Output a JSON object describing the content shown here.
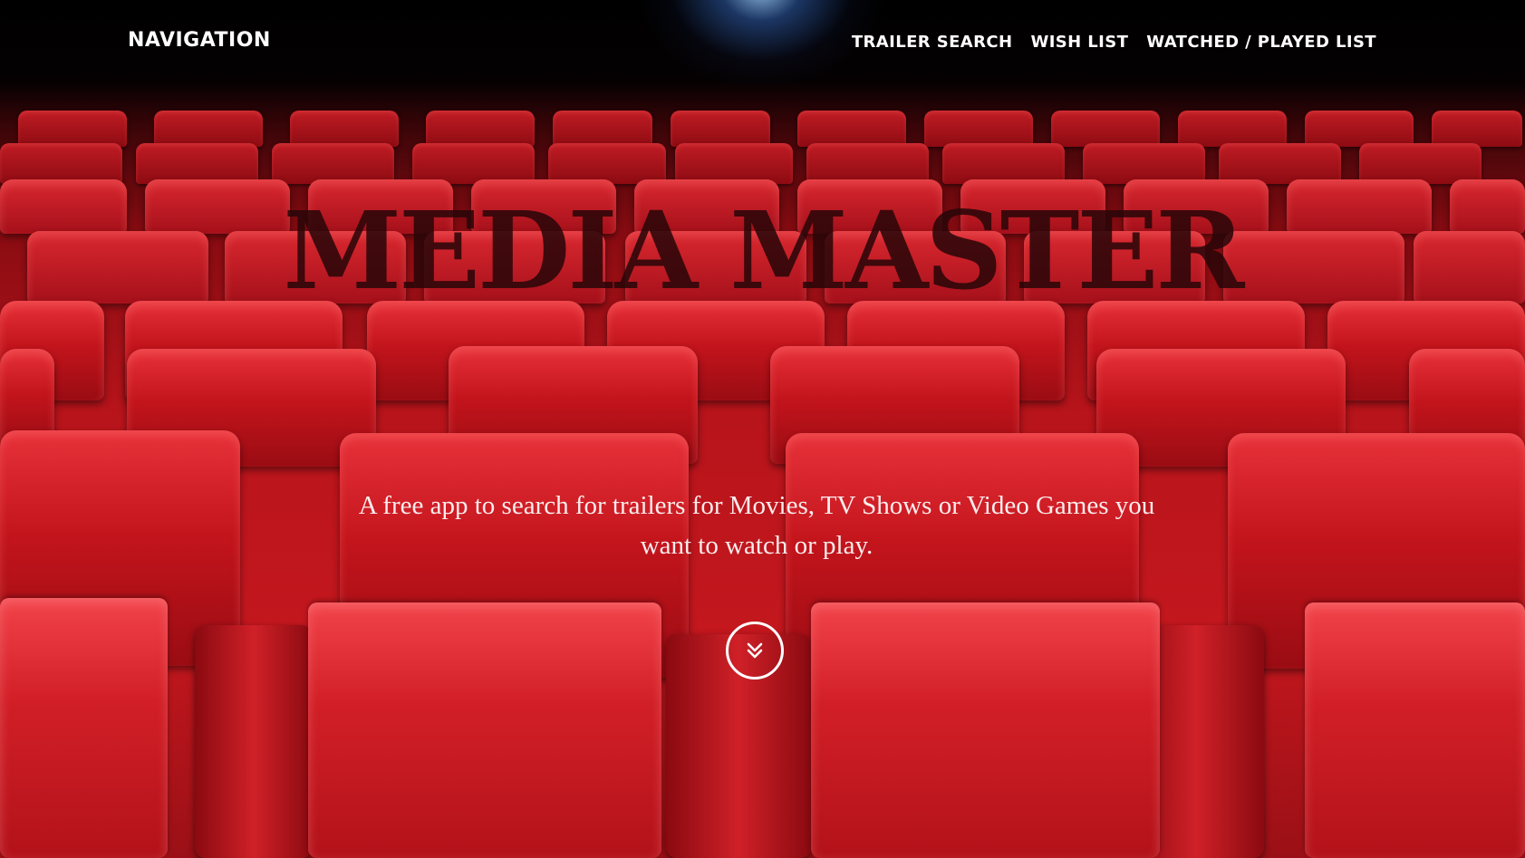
{
  "nav": {
    "brand": "NAVIGATION",
    "links": [
      {
        "label": "TRAILER SEARCH"
      },
      {
        "label": "WISH LIST"
      },
      {
        "label": "WATCHED / PLAYED LIST"
      }
    ]
  },
  "hero": {
    "title": "MEDIA MASTER",
    "subtitle": "A free app to search for trailers for Movies, TV Shows or Video Games you want to watch or play.",
    "scroll_icon": "chevron-double-down-icon"
  },
  "colors": {
    "seat_red": "#c4171e",
    "text_white": "#ffffff",
    "title_dark": "#280608"
  }
}
